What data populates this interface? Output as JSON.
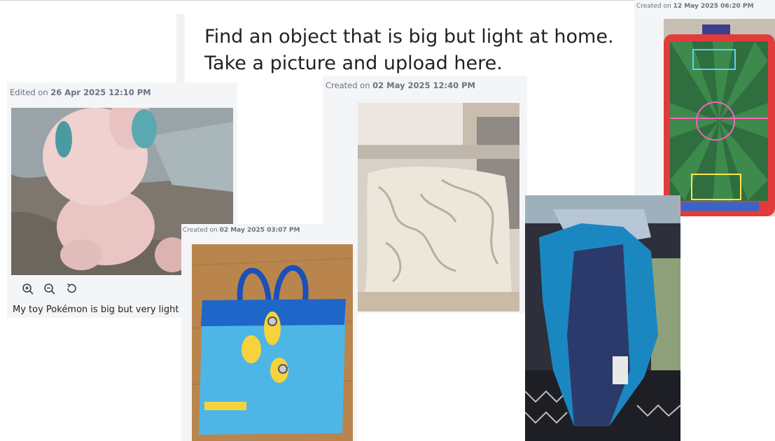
{
  "question": {
    "line1": "Find an object that is big but light at home.",
    "line2": "Take a picture and upload here."
  },
  "posts": [
    {
      "meta_prefix": "Edited on ",
      "meta_date": "26 Apr 2025 12:10 PM",
      "image": "pink-plush-toy-photo",
      "caption": "My toy Pokémon is big but very light",
      "tools": [
        "zoom-in-icon",
        "zoom-out-icon",
        "reset-icon"
      ]
    },
    {
      "meta_prefix": "Created on ",
      "meta_date": "02 May 2025 03:07 PM",
      "image": "minions-tote-bag-photo"
    },
    {
      "meta_prefix": "Created on ",
      "meta_date": "02 May 2025 12:40 PM",
      "image": "cushion-pillow-photo"
    },
    {
      "meta_prefix": "Created on ",
      "meta_date": "12 May 2025 06:20 PM",
      "image": "tabletop-air-hockey-photo"
    },
    {
      "image": "blue-jacket-photo"
    }
  ],
  "colors": {
    "page_bg": "#ffffff",
    "card_bg": "#f4f5f7",
    "meta_text": "#6b7280",
    "question_text": "#222222"
  }
}
